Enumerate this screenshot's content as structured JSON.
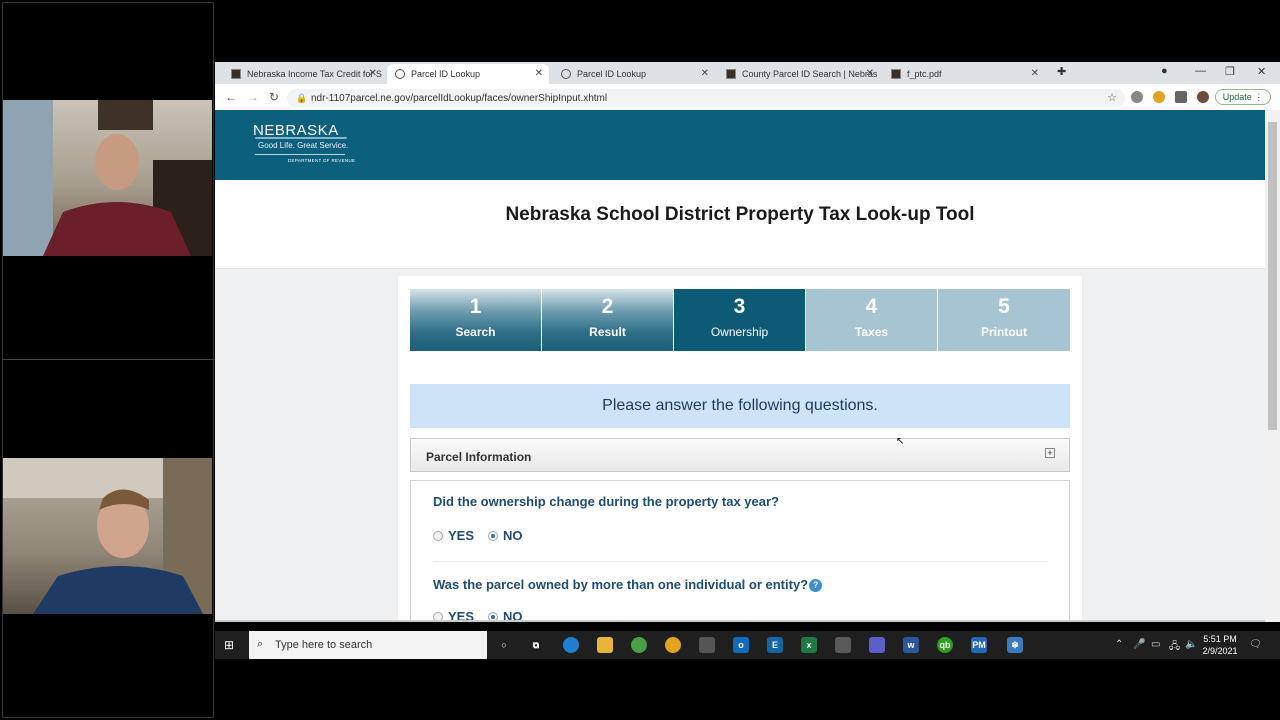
{
  "browser": {
    "tabs": [
      {
        "title": "Nebraska Income Tax Credit for S",
        "active": false
      },
      {
        "title": "Parcel ID Lookup",
        "active": true
      },
      {
        "title": "Parcel ID Lookup",
        "active": false
      },
      {
        "title": "County Parcel ID Search | Nebras",
        "active": false
      },
      {
        "title": "f_ptc.pdf",
        "active": false
      }
    ],
    "url": "ndr-1107parcel.ne.gov/parcelIdLookup/faces/ownerShipInput.xhtml",
    "update_label": "Update"
  },
  "site": {
    "logo": "NEBRASKA",
    "tagline": "Good Life. Great Service.",
    "dept": "DEPARTMENT OF REVENUE",
    "page_title": "Nebraska School District Property Tax Look-up Tool"
  },
  "steps": [
    {
      "num": "1",
      "label": "Search",
      "state": "done"
    },
    {
      "num": "2",
      "label": "Result",
      "state": "done"
    },
    {
      "num": "3",
      "label": "Ownership",
      "state": "current"
    },
    {
      "num": "4",
      "label": "Taxes",
      "state": "future"
    },
    {
      "num": "5",
      "label": "Printout",
      "state": "future"
    }
  ],
  "notice": "Please answer the following questions.",
  "panel": {
    "title": "Parcel Information",
    "toggle": "+"
  },
  "questions": [
    {
      "text": "Did the ownership change during the property tax year?",
      "yes": "YES",
      "no": "NO",
      "selected": "NO"
    },
    {
      "text": "Was the parcel owned by more than one individual or entity?",
      "help": "?",
      "yes": "YES",
      "no": "NO",
      "selected": "NO"
    }
  ],
  "taskbar": {
    "search_placeholder": "Type here to search",
    "time": "5:51 PM",
    "date": "2/9/2021"
  }
}
